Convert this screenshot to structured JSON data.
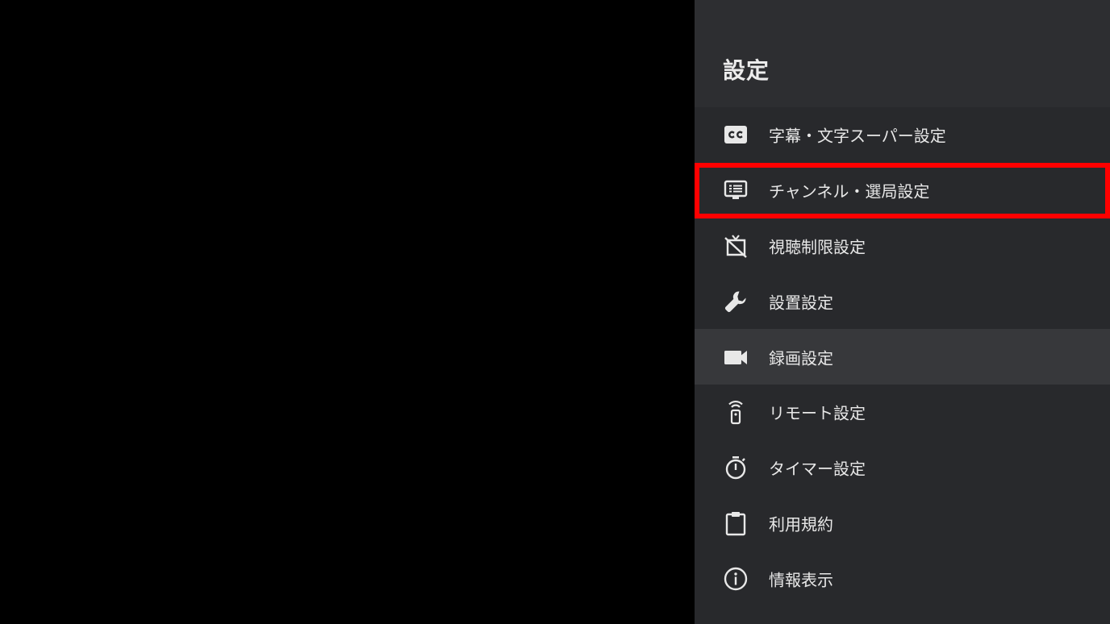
{
  "panel": {
    "title": "設定",
    "items": [
      {
        "label": "字幕・文字スーパー設定",
        "icon": "closed-caption-icon"
      },
      {
        "label": "チャンネル・選局設定",
        "icon": "channel-list-icon"
      },
      {
        "label": "視聴制限設定",
        "icon": "tv-off-icon"
      },
      {
        "label": "設置設定",
        "icon": "wrench-icon"
      },
      {
        "label": "録画設定",
        "icon": "video-camera-icon"
      },
      {
        "label": "リモート設定",
        "icon": "remote-icon"
      },
      {
        "label": "タイマー設定",
        "icon": "timer-icon"
      },
      {
        "label": "利用規約",
        "icon": "clipboard-icon"
      },
      {
        "label": "情報表示",
        "icon": "info-icon"
      }
    ]
  },
  "colors": {
    "background": "#000000",
    "panel": "#28292c",
    "panel_header": "#2d2e31",
    "hover_row": "#37383b",
    "selection_outline": "#ff0000",
    "text": "#e8e8e8"
  }
}
